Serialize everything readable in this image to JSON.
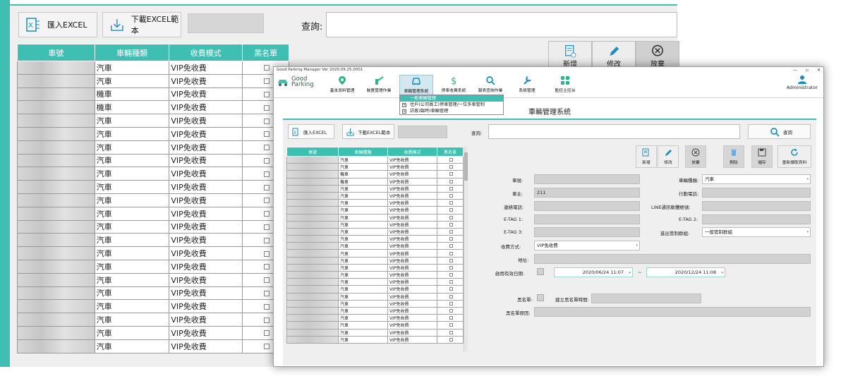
{
  "bg": {
    "import_label": "匯入EXCEL",
    "download_label": "下載EXCEL範本",
    "query_label": "查詢:",
    "columns": [
      "車號",
      "車輛種類",
      "收費模式",
      "黑名單"
    ],
    "rows": [
      {
        "type": "汽車",
        "mode": "VIP免收費"
      },
      {
        "type": "汽車",
        "mode": "VIP免收費"
      },
      {
        "type": "機車",
        "mode": "VIP免收費"
      },
      {
        "type": "機車",
        "mode": "VIP免收費"
      },
      {
        "type": "汽車",
        "mode": "VIP免收費"
      },
      {
        "type": "汽車",
        "mode": "VIP免收費"
      },
      {
        "type": "汽車",
        "mode": "VIP免收費"
      },
      {
        "type": "汽車",
        "mode": "VIP免收費"
      },
      {
        "type": "汽車",
        "mode": "VIP免收費"
      },
      {
        "type": "汽車",
        "mode": "VIP免收費"
      },
      {
        "type": "汽車",
        "mode": "VIP免收費"
      },
      {
        "type": "汽車",
        "mode": "VIP免收費"
      },
      {
        "type": "汽車",
        "mode": "VIP免收費"
      },
      {
        "type": "汽車",
        "mode": "VIP免收費"
      },
      {
        "type": "汽車",
        "mode": "VIP免收費"
      },
      {
        "type": "汽車",
        "mode": "VIP免收費"
      },
      {
        "type": "汽車",
        "mode": "VIP免收費"
      },
      {
        "type": "汽車",
        "mode": "VIP免收費"
      },
      {
        "type": "汽車",
        "mode": "VIP免收費"
      },
      {
        "type": "汽車",
        "mode": "VIP免收費"
      },
      {
        "type": "汽車",
        "mode": "VIP免收費"
      },
      {
        "type": "汽車",
        "mode": "VIP免收費"
      }
    ],
    "toolbar": [
      "新增",
      "修改",
      "放棄"
    ]
  },
  "app": {
    "title": "Good Parking Manager Ver 2020.09.25.0001",
    "logo_line1": "Good",
    "logo_line2": "Parking",
    "ribbon": [
      "基本資料管理",
      "裝置管理作業",
      "車輛管理系統",
      "停車收費系統",
      "報表查詢作業",
      "系統管理",
      "監控主控台"
    ],
    "user": "Administrator",
    "menu": [
      "一般車輛管理",
      "住戶(公司員工)停車管理/一位多車管制",
      "訪客(臨時)車輛管理"
    ],
    "header": "車輛管理系統",
    "import_label": "匯入EXCEL",
    "download_label": "下載EXCEL範本",
    "query_label": "查詢:",
    "search_label": "查詢",
    "columns": [
      "車號",
      "車輛種類",
      "收費模式",
      "黑名單"
    ],
    "rows": [
      {
        "type": "汽車",
        "mode": "VIP免收費"
      },
      {
        "type": "汽車",
        "mode": "VIP免收費"
      },
      {
        "type": "機車",
        "mode": "VIP免收費"
      },
      {
        "type": "機車",
        "mode": "VIP免收費"
      },
      {
        "type": "汽車",
        "mode": "VIP免收費"
      },
      {
        "type": "汽車",
        "mode": "VIP免收費"
      },
      {
        "type": "汽車",
        "mode": "VIP免收費"
      },
      {
        "type": "汽車",
        "mode": "VIP免收費"
      },
      {
        "type": "汽車",
        "mode": "VIP免收費"
      },
      {
        "type": "汽車",
        "mode": "VIP免收費"
      },
      {
        "type": "汽車",
        "mode": "VIP免收費"
      },
      {
        "type": "汽車",
        "mode": "VIP免收費"
      },
      {
        "type": "汽車",
        "mode": "VIP免收費"
      },
      {
        "type": "汽車",
        "mode": "VIP免收費"
      },
      {
        "type": "汽車",
        "mode": "VIP免收費"
      },
      {
        "type": "汽車",
        "mode": "VIP免收費"
      },
      {
        "type": "汽車",
        "mode": "VIP免收費"
      },
      {
        "type": "汽車",
        "mode": "VIP免收費"
      },
      {
        "type": "汽車",
        "mode": "VIP免收費"
      },
      {
        "type": "汽車",
        "mode": "VIP免收費"
      },
      {
        "type": "汽車",
        "mode": "VIP免收費"
      },
      {
        "type": "汽車",
        "mode": "VIP免收費"
      },
      {
        "type": "汽車",
        "mode": "VIP免收費"
      },
      {
        "type": "汽車",
        "mode": "VIP免收費"
      },
      {
        "type": "汽車",
        "mode": "VIP免收費"
      },
      {
        "type": "汽車",
        "mode": "VIP免收費"
      }
    ],
    "tools": [
      "新增",
      "修改",
      "放棄",
      "刪除",
      "儲存",
      "重新讀取資料"
    ],
    "form": {
      "plate_label": "車號:",
      "owner_label": "車主:",
      "owner_value": "211",
      "phone_label": "連絡電話:",
      "etag1_label": "E-TAG 1:",
      "etag3_label": "E-TAG 3:",
      "charge_label": "收費方式:",
      "charge_value": "VIP免收費",
      "vtype_label": "車輛種類:",
      "vtype_value": "汽車",
      "mobile_label": "行動電話:",
      "line_label": "LINE通訊軟體帳號:",
      "etag2_label": "E-TAG 2:",
      "group_label": "進出管制群組:",
      "group_value": "一般管制群組",
      "address_label": "地址:",
      "valid_label": "啟用有效日期:",
      "date_from": "2020/06/24 11:07",
      "date_sep": "~",
      "date_to": "2020/12/24 11:08",
      "blacklist_label": "黑名單:",
      "bl_time_label": "建立黑名單時間:",
      "bl_reason_label": "黑名單原因:"
    }
  }
}
